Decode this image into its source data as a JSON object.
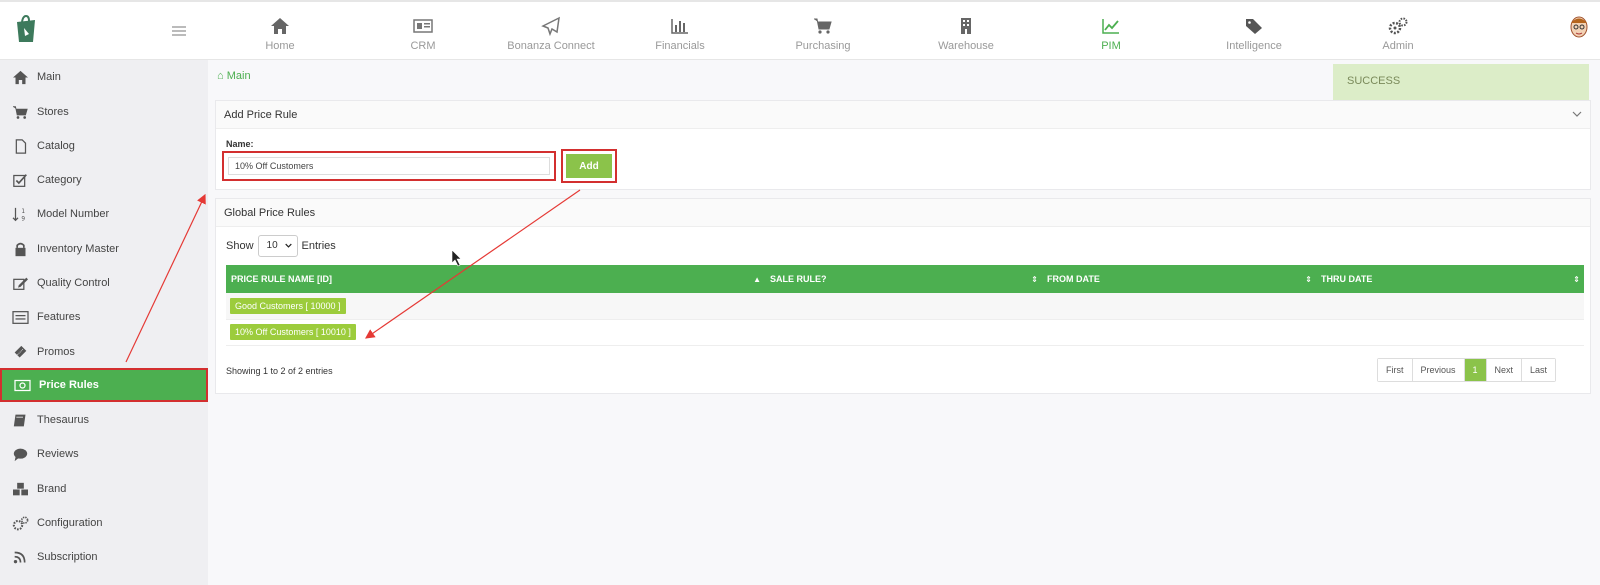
{
  "nav": {
    "items": [
      {
        "label": "Home",
        "icon": "home-icon"
      },
      {
        "label": "CRM",
        "icon": "id-card-icon"
      },
      {
        "label": "Bonanza Connect",
        "icon": "paper-plane-icon"
      },
      {
        "label": "Financials",
        "icon": "bar-chart-icon"
      },
      {
        "label": "Purchasing",
        "icon": "cart-icon"
      },
      {
        "label": "Warehouse",
        "icon": "building-icon"
      },
      {
        "label": "PIM",
        "icon": "line-chart-icon",
        "active": true
      },
      {
        "label": "Intelligence",
        "icon": "tags-icon"
      },
      {
        "label": "Admin",
        "icon": "gears-icon"
      }
    ]
  },
  "sidebar": {
    "items": [
      {
        "label": "Main",
        "icon": "home-icon"
      },
      {
        "label": "Stores",
        "icon": "cart-icon"
      },
      {
        "label": "Catalog",
        "icon": "file-icon"
      },
      {
        "label": "Category",
        "icon": "check-square-icon"
      },
      {
        "label": "Model Number",
        "icon": "sort-numeric-icon"
      },
      {
        "label": "Inventory Master",
        "icon": "lock-icon"
      },
      {
        "label": "Quality Control",
        "icon": "edit-icon"
      },
      {
        "label": "Features",
        "icon": "list-icon"
      },
      {
        "label": "Promos",
        "icon": "ticket-icon"
      },
      {
        "label": "Price Rules",
        "icon": "money-icon",
        "active": true
      },
      {
        "label": "Thesaurus",
        "icon": "book-icon"
      },
      {
        "label": "Reviews",
        "icon": "comment-icon"
      },
      {
        "label": "Brand",
        "icon": "cubes-icon"
      },
      {
        "label": "Configuration",
        "icon": "gears-icon"
      },
      {
        "label": "Subscription",
        "icon": "rss-icon"
      }
    ]
  },
  "breadcrumb": {
    "label": "Main"
  },
  "toast": {
    "text": "SUCCESS"
  },
  "add_panel": {
    "title": "Add Price Rule",
    "name_label": "Name:",
    "name_value": "10% Off Customers",
    "add_label": "Add"
  },
  "rules_panel": {
    "title": "Global Price Rules",
    "show_label": "Show",
    "page_size": "10",
    "entries_label": "Entries",
    "columns": [
      "PRICE RULE NAME [ID]",
      "SALE RULE?",
      "FROM DATE",
      "THRU DATE"
    ],
    "rows": [
      {
        "name": "Good Customers [ 10000 ]",
        "sale_rule": "",
        "from_date": "",
        "thru_date": ""
      },
      {
        "name": "10% Off Customers [ 10010 ]",
        "sale_rule": "",
        "from_date": "",
        "thru_date": ""
      }
    ],
    "showing_text": "Showing 1 to 2 of 2 entries",
    "pager": [
      "First",
      "Previous",
      "1",
      "Next",
      "Last"
    ],
    "current_page": "1"
  },
  "colors": {
    "accent": "#4caf50",
    "chip": "#9ccc3c",
    "annotation": "#d32f2f",
    "toast_bg": "#dcedc8"
  }
}
